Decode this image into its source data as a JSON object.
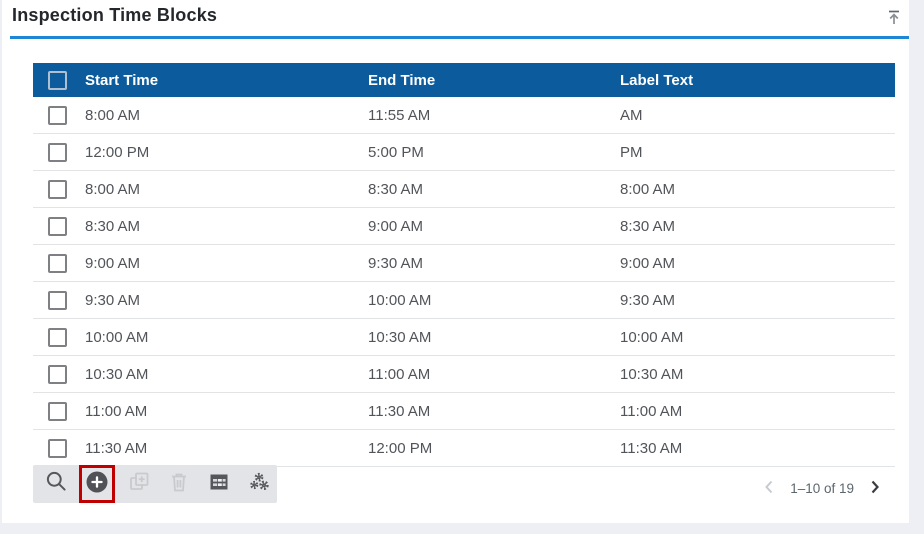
{
  "panel": {
    "title": "Inspection Time Blocks"
  },
  "table": {
    "headers": [
      "Start Time",
      "End Time",
      "Label Text"
    ],
    "rows": [
      {
        "start": "8:00 AM",
        "end": "11:55 AM",
        "label": "AM"
      },
      {
        "start": "12:00 PM",
        "end": "5:00 PM",
        "label": "PM"
      },
      {
        "start": "8:00 AM",
        "end": "8:30 AM",
        "label": "8:00 AM"
      },
      {
        "start": "8:30 AM",
        "end": "9:00 AM",
        "label": "8:30 AM"
      },
      {
        "start": "9:00 AM",
        "end": "9:30 AM",
        "label": "9:00 AM"
      },
      {
        "start": "9:30 AM",
        "end": "10:00 AM",
        "label": "9:30 AM"
      },
      {
        "start": "10:00 AM",
        "end": "10:30 AM",
        "label": "10:00 AM"
      },
      {
        "start": "10:30 AM",
        "end": "11:00 AM",
        "label": "10:30 AM"
      },
      {
        "start": "11:00 AM",
        "end": "11:30 AM",
        "label": "11:00 AM"
      },
      {
        "start": "11:30 AM",
        "end": "12:00 PM",
        "label": "11:30 AM"
      }
    ]
  },
  "toolbar": {
    "buttons": [
      {
        "name": "search-icon",
        "enabled": true
      },
      {
        "name": "add-icon",
        "enabled": true,
        "highlighted": true
      },
      {
        "name": "duplicate-icon",
        "enabled": false
      },
      {
        "name": "delete-icon",
        "enabled": false
      },
      {
        "name": "table-grid-icon",
        "enabled": true
      },
      {
        "name": "settings-gears-icon",
        "enabled": true
      }
    ],
    "highlight_color": "#c00000"
  },
  "pagination": {
    "range_label": "1–10 of 19",
    "prev_enabled": false,
    "next_enabled": true
  },
  "colors": {
    "header_bg": "#0c5c9d",
    "title_underline": "#1e87d5",
    "toolbar_bg": "#e3e4e7",
    "annotation_red": "#c00000",
    "page_bg": "#edeff4",
    "row_text": "#515459",
    "icon_dark": "#56575b",
    "icon_disabled": "#c9cacd"
  }
}
